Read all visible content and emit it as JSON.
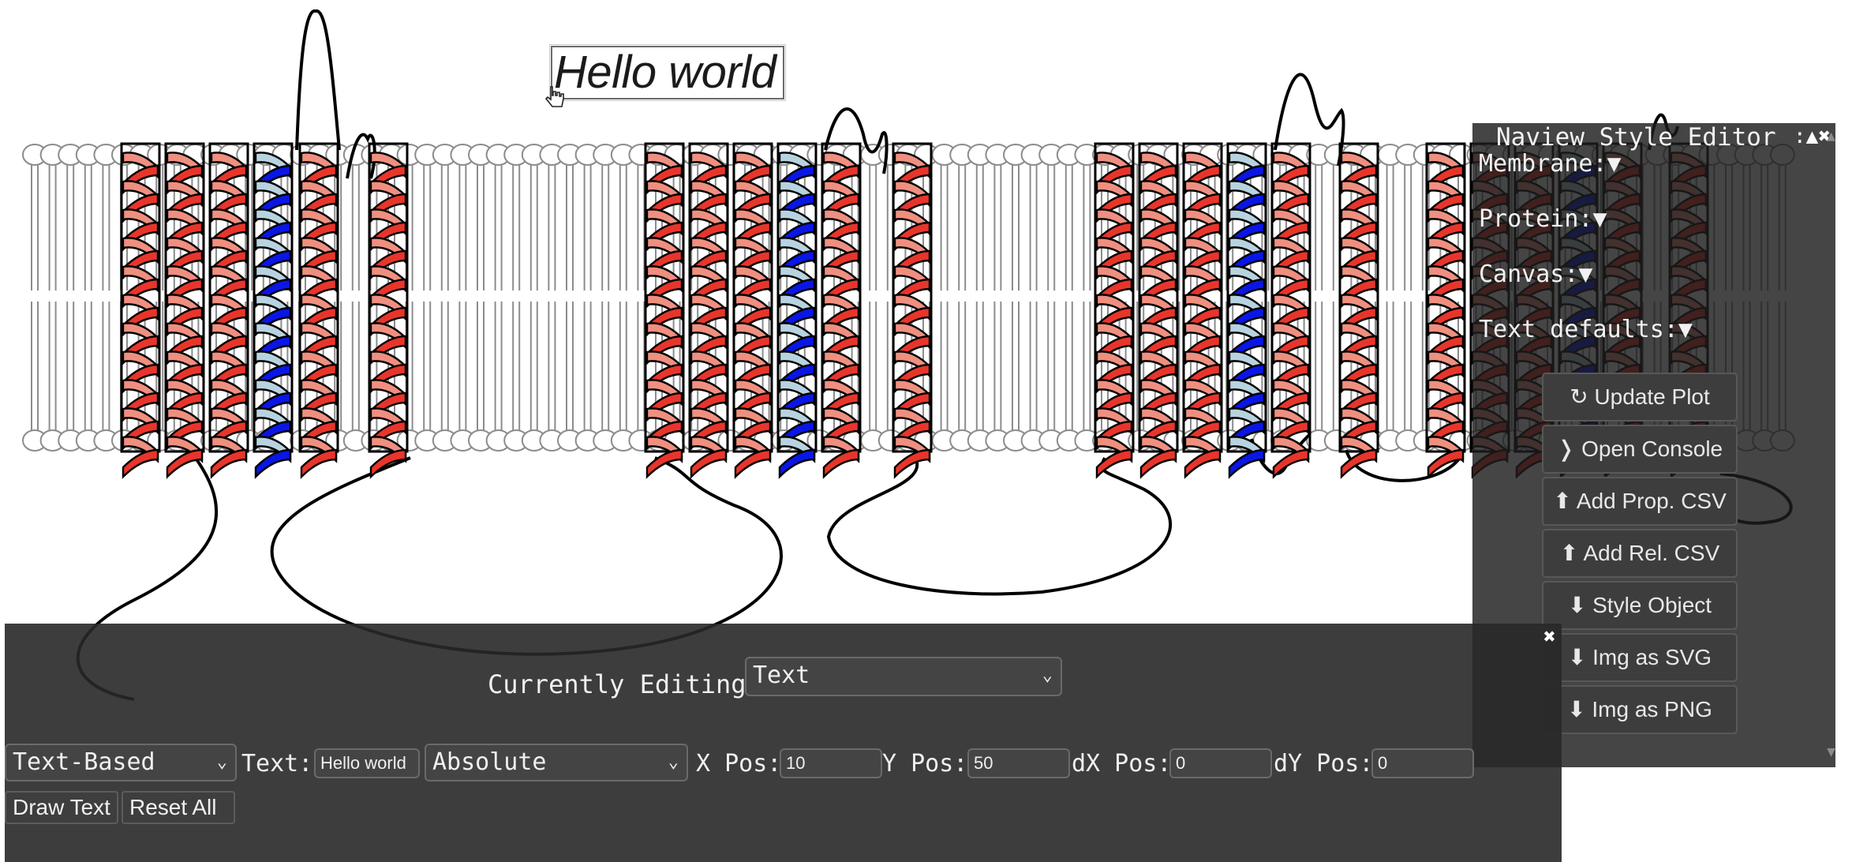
{
  "canvas": {
    "text_label": "Hello world",
    "colors": {
      "helix_red": "#e8352b",
      "helix_salmon": "#ef8f80",
      "helix_blue": "#0a16e6",
      "helix_lightblue": "#b8d3e0",
      "lipid": "#888888",
      "loop": "#000000"
    }
  },
  "style_editor": {
    "title": "Naview Style Editor",
    "controls": ":▲✖",
    "sections": [
      "Membrane:▼",
      "Protein:▼",
      "Canvas:▼",
      "Text defaults:▼"
    ],
    "buttons": [
      "↻ Update Plot",
      "❭ Open Console",
      "⬆ Add Prop. CSV",
      "⬆ Add Rel. CSV",
      "⬇ Style Object",
      "⬇ Img as SVG",
      "⬇ Img as PNG"
    ]
  },
  "bottom_panel": {
    "close": "✖",
    "editing_label": "Currently Editing:",
    "editing_value": "Text",
    "mode_value": "Text-Based",
    "text_label": "Text:",
    "text_value": "Hello world",
    "position_mode": "Absolute",
    "x_label": "X Pos:",
    "x_value": "10",
    "y_label": "Y Pos:",
    "y_value": "50",
    "dx_label": "dX Pos:",
    "dx_value": "0",
    "dy_label": "dY Pos:",
    "dy_value": "0",
    "draw_button": "Draw Text",
    "reset_button": "Reset All"
  }
}
